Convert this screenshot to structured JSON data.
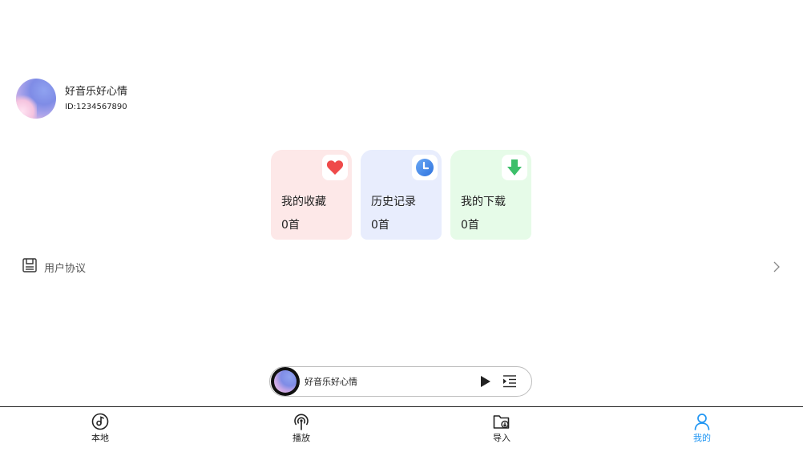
{
  "profile": {
    "username": "好音乐好心情",
    "user_id": "ID:1234567890"
  },
  "cards": [
    {
      "title": "我的收藏",
      "count": "0首",
      "icon": "heart-icon",
      "bg": "#fde8e8",
      "icon_color": "#ef4a4a"
    },
    {
      "title": "历史记录",
      "count": "0首",
      "icon": "clock-icon",
      "bg": "#e8edfd",
      "icon_color": "#3e85e8"
    },
    {
      "title": "我的下载",
      "count": "0首",
      "icon": "download-arrow-icon",
      "bg": "#e6fbe8",
      "icon_color": "#3cbf6a"
    }
  ],
  "agreement": {
    "label": "用户协议",
    "icon": "document-icon"
  },
  "player": {
    "title": "好音乐好心情",
    "play_icon": "play-icon",
    "playlist_icon": "playlist-icon"
  },
  "tabs": [
    {
      "label": "本地",
      "icon": "music-note-disc-icon",
      "active": false
    },
    {
      "label": "播放",
      "icon": "broadcast-icon",
      "active": false
    },
    {
      "label": "导入",
      "icon": "folder-import-icon",
      "active": false
    },
    {
      "label": "我的",
      "icon": "user-icon",
      "active": true
    }
  ],
  "colors": {
    "accent": "#2196f3",
    "text": "#222222"
  }
}
